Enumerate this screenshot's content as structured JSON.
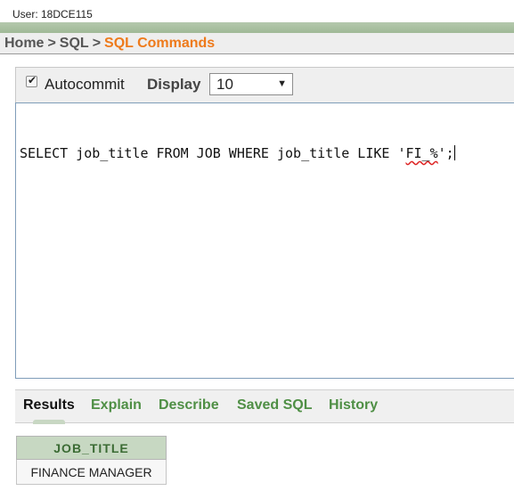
{
  "header": {
    "user_label": "User: 18DCE115"
  },
  "breadcrumb": {
    "home": "Home",
    "sql": "SQL",
    "current": "SQL Commands",
    "separator": ">"
  },
  "toolbar": {
    "autocommit_label": "Autocommit",
    "autocommit_checked": true,
    "display_label": "Display",
    "display_value": "10"
  },
  "editor": {
    "sql_before": "SELECT job_title FROM JOB WHERE job_title LIKE '",
    "sql_spell": "FI_%",
    "sql_after": "';"
  },
  "tabs": [
    {
      "label": "Results",
      "active": true
    },
    {
      "label": "Explain"
    },
    {
      "label": "Describe"
    },
    {
      "label": "Saved SQL"
    },
    {
      "label": "History"
    }
  ],
  "results": {
    "columns": [
      "JOB_TITLE"
    ],
    "rows": [
      [
        "FINANCE MANAGER"
      ]
    ]
  },
  "colors": {
    "accent_orange": "#ee7a1b",
    "tab_green": "#4f8f45",
    "header_green": "#c7d8c2"
  }
}
